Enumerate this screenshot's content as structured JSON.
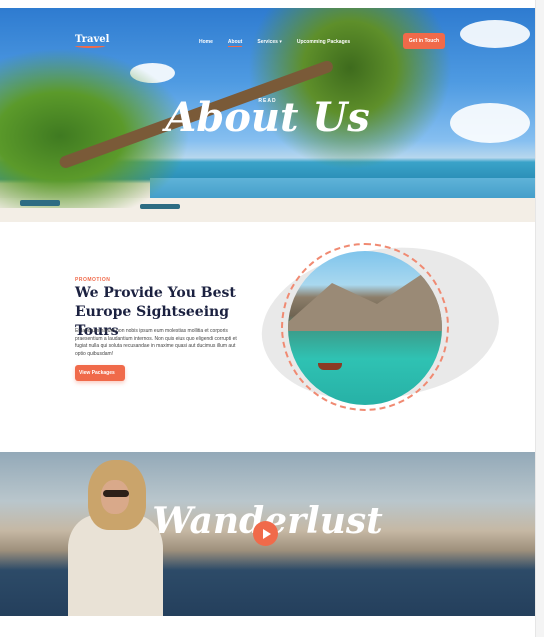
{
  "brand": {
    "logo_text": "Travel"
  },
  "nav": {
    "items": [
      {
        "label": "Home"
      },
      {
        "label": "About"
      },
      {
        "label": "Services ▾"
      },
      {
        "label": "Upcomming Packages"
      }
    ],
    "cta_label": "Get in Touch"
  },
  "hero": {
    "kicker": "READ",
    "title": "About Us"
  },
  "promo": {
    "kicker": "PROMOTION",
    "title": "We Provide You Best Europe Sightseeing Tours",
    "text": "Et laborum harum non nobis ipsum eum molestias mollitia et corporis praesentium a laudantium internos. Non quis eius quo eligendi corrupti et fugiat nulla qui soluta recusandae in maxime quasi aut ducimus illum aut optio quibusdam!",
    "button_label": "View Packages"
  },
  "video": {
    "title": "Wanderlust"
  },
  "colors": {
    "accent": "#f06a4a",
    "heading": "#1b2140"
  },
  "icons": {
    "play": "play-icon"
  }
}
